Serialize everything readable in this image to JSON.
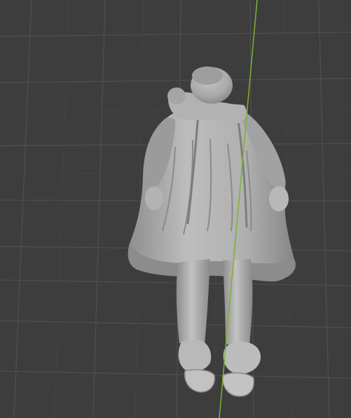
{
  "viewport": {
    "view": "perspective",
    "background_color": "#3d3d3d",
    "grid_line_color": "#4e4e4e",
    "y_axis_color": "#7fb12e",
    "model": {
      "type": "sculpted-figure",
      "shading": "solid",
      "base_color": "#a6a6a6"
    }
  }
}
